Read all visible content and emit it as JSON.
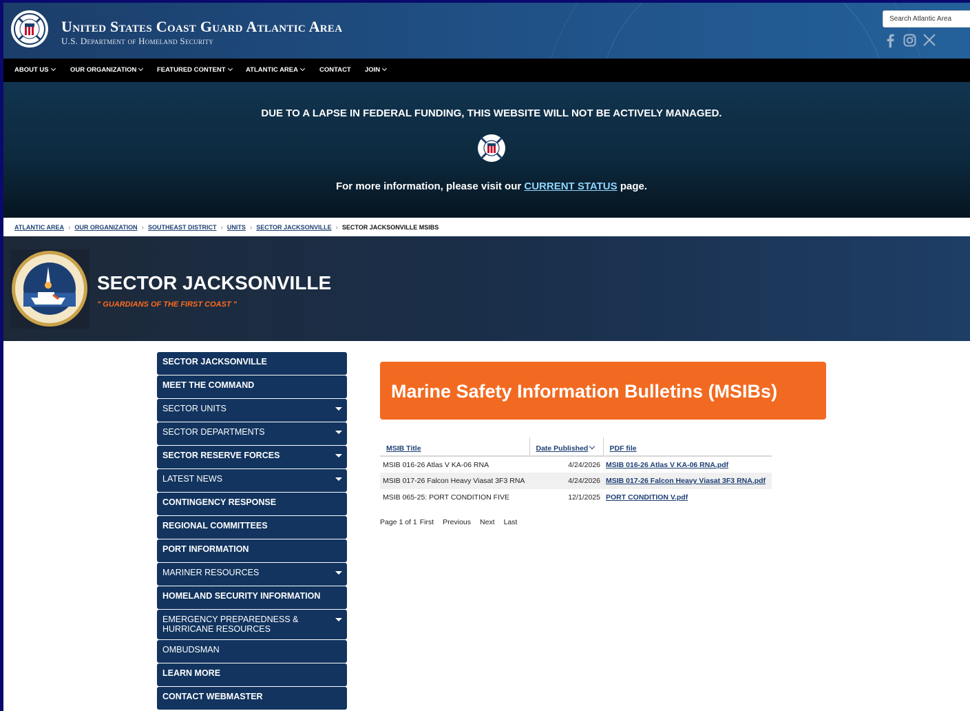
{
  "header": {
    "title": "United States Coast Guard Atlantic Area",
    "subtitle": "U.S. Department of Homeland Security",
    "search_placeholder": "Search Atlantic Area",
    "social": [
      "facebook-icon",
      "instagram-icon",
      "x-icon"
    ]
  },
  "nav": {
    "items": [
      {
        "label": "ABOUT US",
        "dropdown": true
      },
      {
        "label": "OUR ORGANIZATION",
        "dropdown": true
      },
      {
        "label": "FEATURED CONTENT",
        "dropdown": true
      },
      {
        "label": "ATLANTIC AREA",
        "dropdown": true
      },
      {
        "label": "CONTACT",
        "dropdown": false
      },
      {
        "label": "JOIN",
        "dropdown": true
      }
    ]
  },
  "banner": {
    "headline": "DUE TO A LAPSE IN FEDERAL FUNDING, THIS WEBSITE WILL NOT BE ACTIVELY MANAGED.",
    "info_prefix": "For more information, please visit our ",
    "info_link": "CURRENT STATUS",
    "info_suffix": " page."
  },
  "breadcrumb": {
    "links": [
      "ATLANTIC AREA",
      "OUR ORGANIZATION",
      "SOUTHEAST DISTRICT",
      "UNITS",
      "SECTOR JACKSONVILLE"
    ],
    "current": "SECTOR JACKSONVILLE MSIBS"
  },
  "hero": {
    "title": "SECTOR JACKSONVILLE",
    "motto": "\" GUARDIANS OF THE FIRST COAST \""
  },
  "sidebar": {
    "items": [
      {
        "label": "SECTOR JACKSONVILLE",
        "bold": true,
        "dropdown": false
      },
      {
        "label": "MEET THE COMMAND",
        "bold": true,
        "dropdown": false
      },
      {
        "label": "SECTOR UNITS",
        "bold": false,
        "dropdown": true
      },
      {
        "label": "SECTOR DEPARTMENTS",
        "bold": false,
        "dropdown": true
      },
      {
        "label": "SECTOR RESERVE FORCES",
        "bold": true,
        "dropdown": true
      },
      {
        "label": "LATEST NEWS",
        "bold": false,
        "dropdown": true
      },
      {
        "label": "CONTINGENCY RESPONSE",
        "bold": true,
        "dropdown": false
      },
      {
        "label": "REGIONAL COMMITTEES",
        "bold": true,
        "dropdown": false
      },
      {
        "label": "PORT INFORMATION",
        "bold": true,
        "dropdown": false
      },
      {
        "label": "MARINER RESOURCES",
        "bold": false,
        "dropdown": true
      },
      {
        "label": "HOMELAND SECURITY INFORMATION",
        "bold": true,
        "dropdown": false
      },
      {
        "label": "EMERGENCY PREPAREDNESS & HURRICANE RESOURCES",
        "bold": false,
        "dropdown": true
      },
      {
        "label": "OMBUDSMAN",
        "bold": false,
        "dropdown": false
      },
      {
        "label": "LEARN MORE",
        "bold": true,
        "dropdown": false
      },
      {
        "label": "CONTACT WEBMASTER",
        "bold": true,
        "dropdown": false
      }
    ]
  },
  "main": {
    "heading": "Marine Safety Information Bulletins (MSIBs)",
    "table": {
      "columns": [
        "MSIB Title",
        "Date Published",
        "PDF file"
      ],
      "rows": [
        {
          "title": "MSIB 016-26 Atlas V KA-06 RNA",
          "date": "4/24/2026",
          "pdf": "MSIB 016-26 Atlas V KA-06 RNA.pdf"
        },
        {
          "title": "MSIB 017-26 Falcon Heavy Viasat 3F3 RNA",
          "date": "4/24/2026",
          "pdf": "MSIB 017-26 Falcon Heavy Viasat 3F3 RNA.pdf"
        },
        {
          "title": "MSIB 065-25: PORT CONDITION FIVE",
          "date": "12/1/2025",
          "pdf": "PORT CONDITION V.pdf"
        }
      ]
    },
    "pager": {
      "status": "Page 1 of 1",
      "first": "First",
      "previous": "Previous",
      "next": "Next",
      "last": "Last"
    }
  },
  "colors": {
    "nav_bg": "#000000",
    "header_bg": "#1f4e82",
    "sidebar_bg": "#12345f",
    "msib_header_bg": "#f26a21",
    "link": "#1e3f74",
    "motto": "#ff6a1c",
    "banner_link": "#8fd5ff"
  }
}
